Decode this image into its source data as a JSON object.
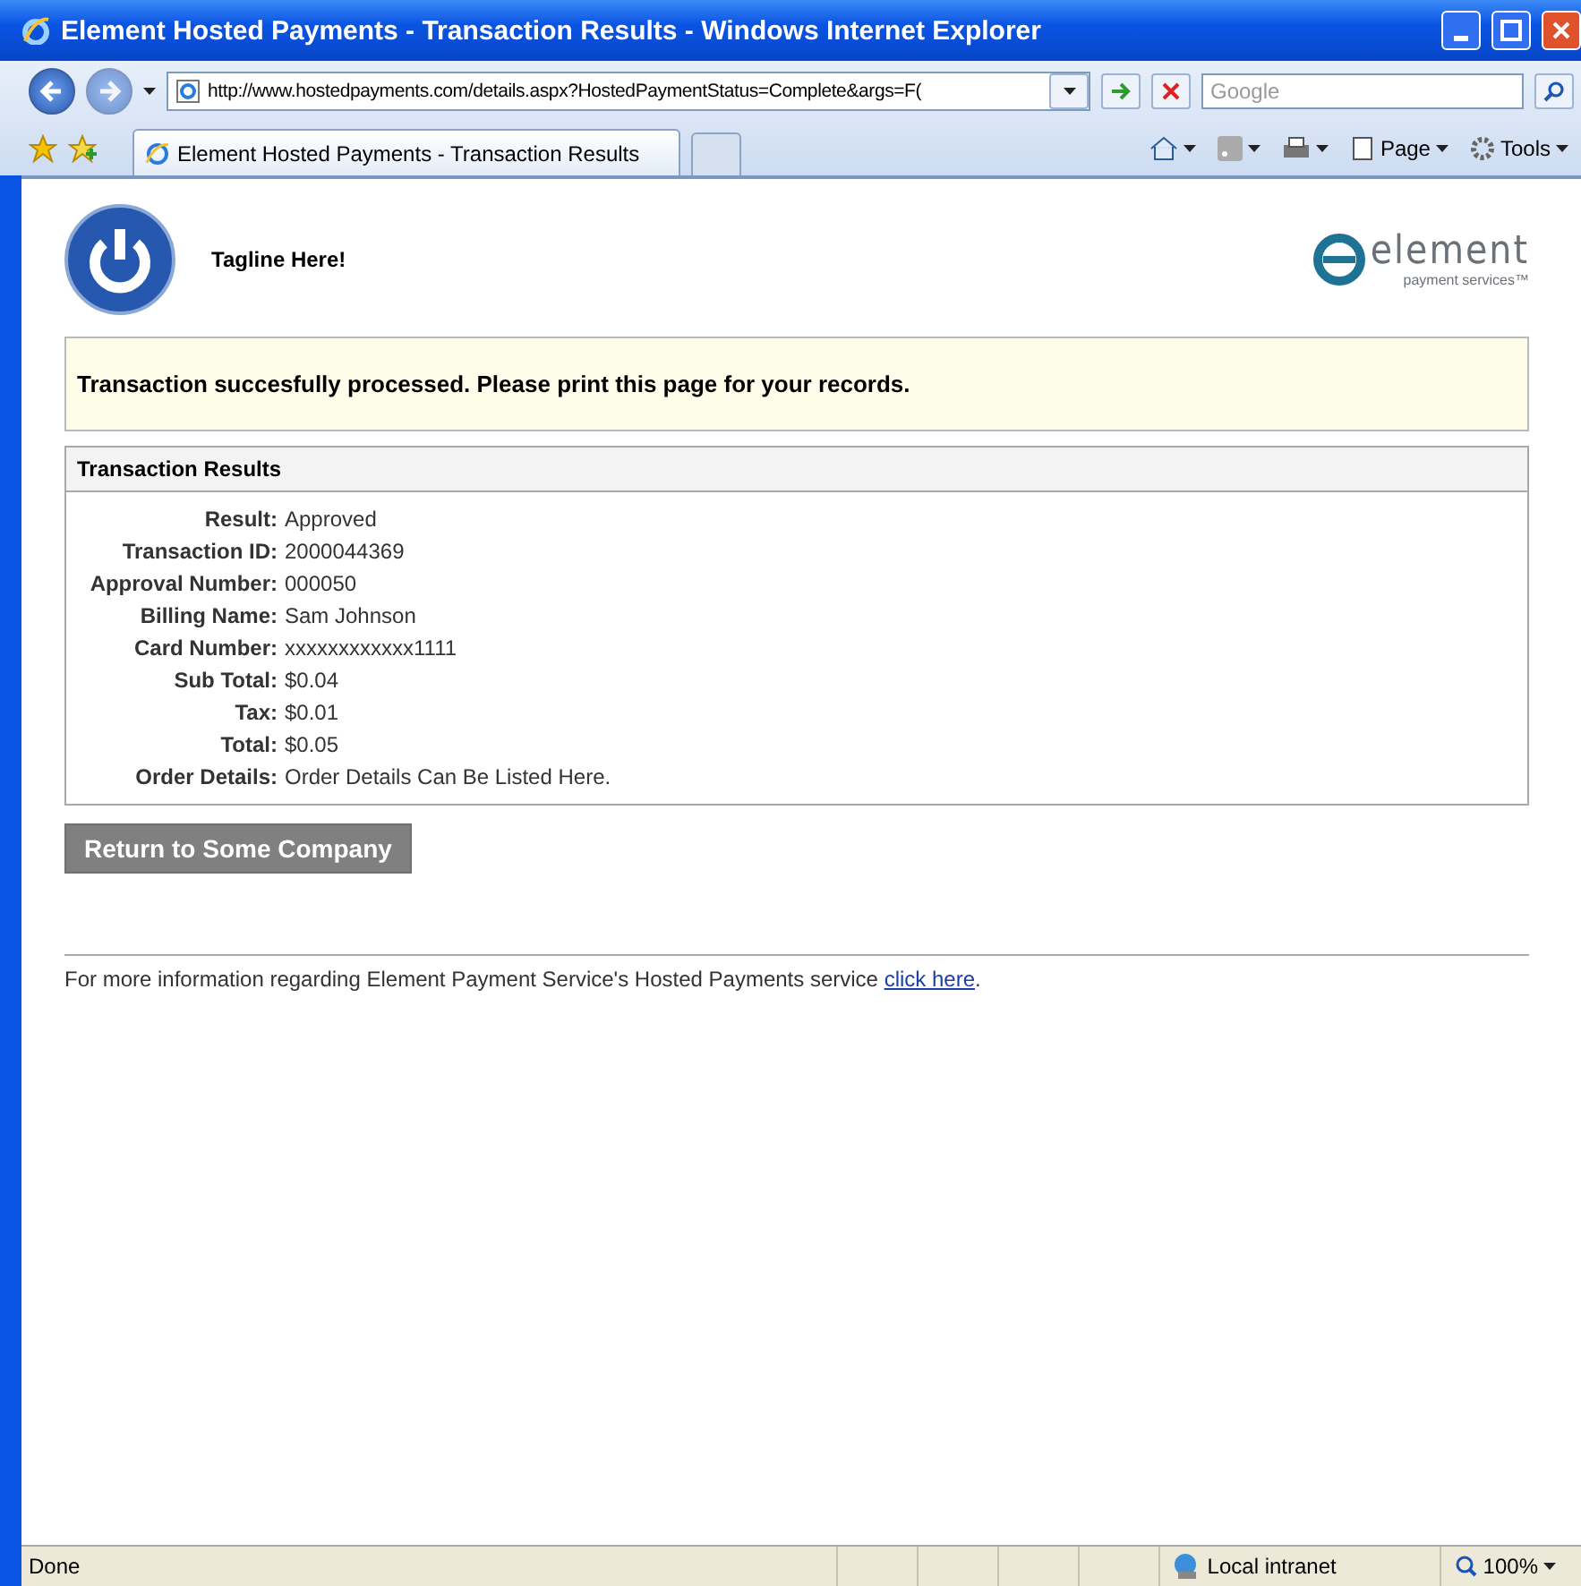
{
  "window": {
    "title": "Element Hosted Payments - Transaction Results - Windows Internet Explorer"
  },
  "address_bar": {
    "url": "http://www.hostedpayments.com/details.aspx?HostedPaymentStatus=Complete&args=F("
  },
  "search": {
    "placeholder": "Google"
  },
  "tabs": [
    {
      "label": "Element Hosted Payments - Transaction Results",
      "selected": true
    }
  ],
  "command_bar": [
    {
      "label": "Page"
    },
    {
      "label": "Tools"
    }
  ],
  "page": {
    "tagline": "Tagline Here!",
    "logo": {
      "name": "element",
      "sub": "payment services™"
    },
    "message": "Transaction succesfully processed. Please print this page for your records.",
    "results": {
      "title": "Transaction Results",
      "rows": [
        {
          "label": "Result:",
          "value": "Approved"
        },
        {
          "label": "Transaction ID:",
          "value": "2000044369"
        },
        {
          "label": "Approval Number:",
          "value": "000050"
        },
        {
          "label": "Billing Name:",
          "value": "Sam Johnson"
        },
        {
          "label": "Card Number:",
          "value": "xxxxxxxxxxxx1111"
        },
        {
          "label": "Sub Total:",
          "value": "$0.04"
        },
        {
          "label": "Tax:",
          "value": "$0.01"
        },
        {
          "label": "Total:",
          "value": "$0.05"
        },
        {
          "label": "Order Details:",
          "value": "Order Details Can Be Listed Here."
        }
      ]
    },
    "button": "Return to Some Company",
    "footer": {
      "before": "For more information regarding Element Payment Service's Hosted Payments service ",
      "link": "click here",
      "after": "."
    }
  },
  "status_bar": {
    "text": "Done",
    "zone": "Local intranet",
    "zoom": "100%"
  }
}
